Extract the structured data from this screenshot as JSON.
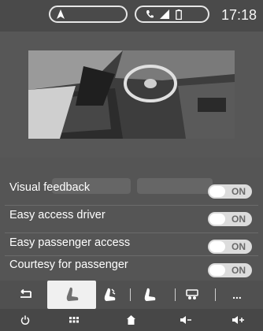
{
  "status": {
    "clock": "17:18"
  },
  "settings": [
    {
      "label": "Visual feedback",
      "state": "ON"
    },
    {
      "label": "Easy access driver",
      "state": "ON"
    },
    {
      "label": "Easy passenger access",
      "state": "ON"
    },
    {
      "label": "Courtesy for passenger",
      "state": "ON"
    }
  ],
  "toolbar": {
    "more_label": "..."
  },
  "icons": {
    "nav": "navigation-arrow-icon",
    "phone": "phone-icon",
    "signal": "signal-icon",
    "battery": "battery-icon",
    "back": "back-arrow-icon",
    "seat_driver": "driver-seat-icon",
    "seat_massage": "seat-massage-icon",
    "seat_passenger": "passenger-seat-icon",
    "settings_extra": "settings-extra-icon",
    "power": "power-icon",
    "apps": "apps-grid-icon",
    "home": "home-icon",
    "vol_down": "volume-down-icon",
    "vol_up": "volume-up-icon"
  },
  "colors": {
    "background": "#555555",
    "toggle_on": "#dcdcdc",
    "active_tab": "#f0f0f0"
  }
}
